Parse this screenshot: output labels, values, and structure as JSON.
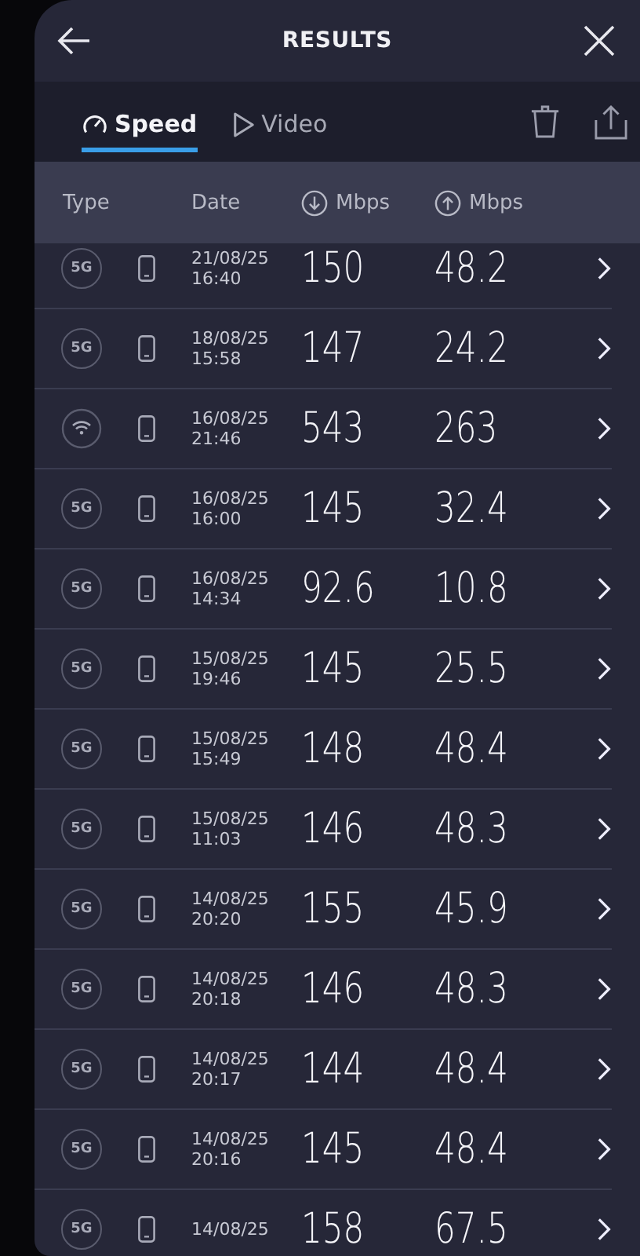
{
  "header": {
    "title": "RESULTS"
  },
  "tabs": [
    {
      "label": "Speed",
      "kind": "speed",
      "selected": true
    },
    {
      "label": "Video",
      "kind": "video",
      "selected": false
    }
  ],
  "columns": {
    "type": "Type",
    "date": "Date",
    "download": "Mbps",
    "upload": "Mbps"
  },
  "rows": [
    {
      "network": {
        "kind": "cellular",
        "label": "5G"
      },
      "date": "21/08/25",
      "time": "16:40",
      "download": "150",
      "upload": "48.2"
    },
    {
      "network": {
        "kind": "cellular",
        "label": "5G"
      },
      "date": "18/08/25",
      "time": "15:58",
      "download": "147",
      "upload": "24.2"
    },
    {
      "network": {
        "kind": "wifi"
      },
      "date": "16/08/25",
      "time": "21:46",
      "download": "543",
      "upload": "263"
    },
    {
      "network": {
        "kind": "cellular",
        "label": "5G"
      },
      "date": "16/08/25",
      "time": "16:00",
      "download": "145",
      "upload": "32.4"
    },
    {
      "network": {
        "kind": "cellular",
        "label": "5G"
      },
      "date": "16/08/25",
      "time": "14:34",
      "download": "92.6",
      "upload": "10.8"
    },
    {
      "network": {
        "kind": "cellular",
        "label": "5G"
      },
      "date": "15/08/25",
      "time": "19:46",
      "download": "145",
      "upload": "25.5"
    },
    {
      "network": {
        "kind": "cellular",
        "label": "5G"
      },
      "date": "15/08/25",
      "time": "15:49",
      "download": "148",
      "upload": "48.4"
    },
    {
      "network": {
        "kind": "cellular",
        "label": "5G"
      },
      "date": "15/08/25",
      "time": "11:03",
      "download": "146",
      "upload": "48.3"
    },
    {
      "network": {
        "kind": "cellular",
        "label": "5G"
      },
      "date": "14/08/25",
      "time": "20:20",
      "download": "155",
      "upload": "45.9"
    },
    {
      "network": {
        "kind": "cellular",
        "label": "5G"
      },
      "date": "14/08/25",
      "time": "20:18",
      "download": "146",
      "upload": "48.3"
    },
    {
      "network": {
        "kind": "cellular",
        "label": "5G"
      },
      "date": "14/08/25",
      "time": "20:17",
      "download": "144",
      "upload": "48.4"
    },
    {
      "network": {
        "kind": "cellular",
        "label": "5G"
      },
      "date": "14/08/25",
      "time": "20:16",
      "download": "145",
      "upload": "48.4"
    },
    {
      "network": {
        "kind": "cellular",
        "label": "5G"
      },
      "date": "14/08/25",
      "download": "158",
      "upload": "67.5"
    }
  ]
}
